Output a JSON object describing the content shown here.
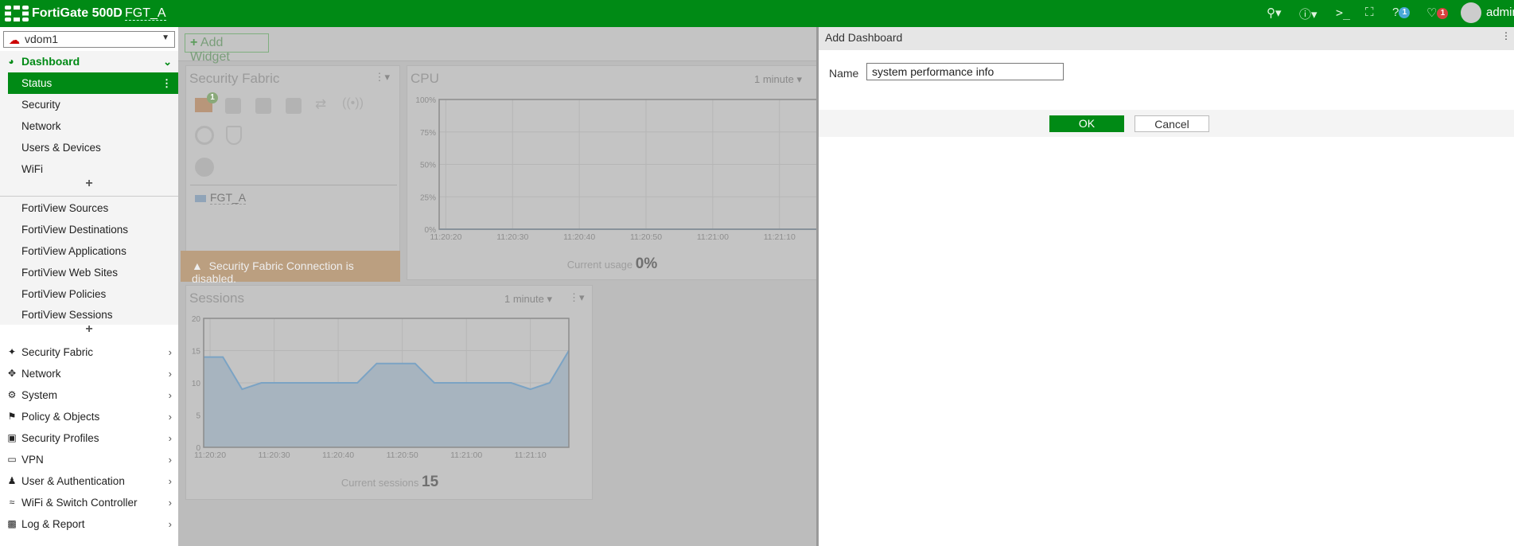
{
  "topbar": {
    "product": "FortiGate 500D",
    "hostname": "FGT_A",
    "help_badge": "1",
    "alerts_badge": "1",
    "user": "admin",
    "icons": [
      "search-icon",
      "feature-icon",
      "cli-icon",
      "fullscreen-icon",
      "help-icon",
      "bell-icon",
      "avatar-icon"
    ]
  },
  "sidebar": {
    "vdom": "vdom1",
    "dashboard": "Dashboard",
    "dashboards": [
      "Status",
      "Security",
      "Network",
      "Users & Devices",
      "WiFi"
    ],
    "fortiview": [
      "FortiView Sources",
      "FortiView Destinations",
      "FortiView Applications",
      "FortiView Web Sites",
      "FortiView Policies",
      "FortiView Sessions"
    ],
    "menu": [
      "Security Fabric",
      "Network",
      "System",
      "Policy & Objects",
      "Security Profiles",
      "VPN",
      "User & Authentication",
      "WiFi & Switch Controller",
      "Log & Report"
    ],
    "add_symbol": "+"
  },
  "main": {
    "add_widget": "Add Widget",
    "security_fabric": {
      "title": "Security Fabric",
      "badge": "1",
      "device": "FGT_A",
      "warning": "Security Fabric Connection is disabled."
    },
    "cpu": {
      "title": "CPU",
      "range": "1 minute",
      "current_label": "Current usage",
      "current_value": "0%"
    },
    "sessions": {
      "title": "Sessions",
      "range": "1 minute",
      "current_label": "Current sessions",
      "current_value": "15"
    }
  },
  "chart_data": [
    {
      "type": "line",
      "title": "CPU",
      "y_ticks": [
        "100%",
        "75%",
        "50%",
        "25%",
        "0%"
      ],
      "ylim": [
        0,
        100
      ],
      "x_ticks": [
        "11:20:20",
        "11:20:30",
        "11:20:40",
        "11:20:50",
        "11:21:00",
        "11:21:10"
      ],
      "values": [
        0,
        0,
        0,
        0,
        0,
        0,
        0,
        0,
        0,
        0,
        0,
        0,
        0,
        0,
        0,
        0,
        0,
        0,
        0,
        0,
        0,
        0,
        0,
        0
      ]
    },
    {
      "type": "area",
      "title": "Sessions",
      "y_ticks": [
        "20",
        "15",
        "10",
        "5",
        "0"
      ],
      "ylim": [
        0,
        20
      ],
      "x_ticks": [
        "11:20:20",
        "11:20:30",
        "11:20:40",
        "11:20:50",
        "11:21:00",
        "11:21:10"
      ],
      "x_step_seconds": 3,
      "values": [
        14,
        14,
        9,
        10,
        10,
        10,
        10,
        10,
        10,
        13,
        13,
        13,
        10,
        10,
        10,
        10,
        10,
        9,
        10,
        15
      ]
    }
  ],
  "dialog": {
    "title": "Add Dashboard",
    "name_label": "Name",
    "name_value": "system performance info",
    "ok": "OK",
    "cancel": "Cancel"
  }
}
